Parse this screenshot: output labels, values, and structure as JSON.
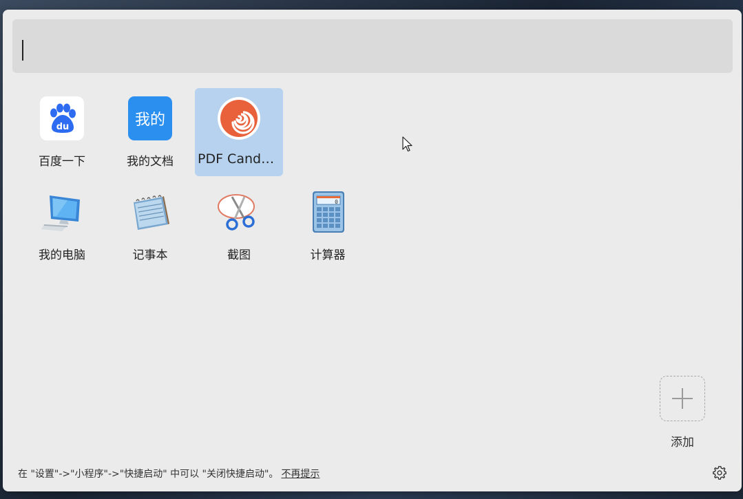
{
  "search": {
    "value": "",
    "placeholder": ""
  },
  "apps": [
    {
      "label": "百度一下",
      "icon": "baidu-icon",
      "selected": false
    },
    {
      "label": "我的文档",
      "icon": "my-documents-icon",
      "icon_text": "我的",
      "selected": false
    },
    {
      "label": "PDF Candy ...",
      "icon": "pdf-candy-icon",
      "selected": true
    },
    {
      "label": "我的电脑",
      "icon": "computer-icon",
      "selected": false
    },
    {
      "label": "记事本",
      "icon": "notepad-icon",
      "selected": false
    },
    {
      "label": "截图",
      "icon": "scissors-icon",
      "selected": false
    },
    {
      "label": "计算器",
      "icon": "calculator-icon",
      "selected": false
    }
  ],
  "add": {
    "label": "添加",
    "icon": "plus-icon"
  },
  "footer": {
    "hint": "在 \"设置\"->\"小程序\"->\"快捷启动\" 中可以 \"关闭快捷启动\"。",
    "no_remind": "不再提示"
  },
  "settings": {
    "icon": "gear-icon"
  },
  "colors": {
    "panel": "#ebebeb",
    "search_bg": "#dadada",
    "selected": "#b6d2ef",
    "baidu_blue": "#2d6bf0",
    "docs_blue": "#2b8ff0",
    "candy_orange": "#e8613a"
  }
}
